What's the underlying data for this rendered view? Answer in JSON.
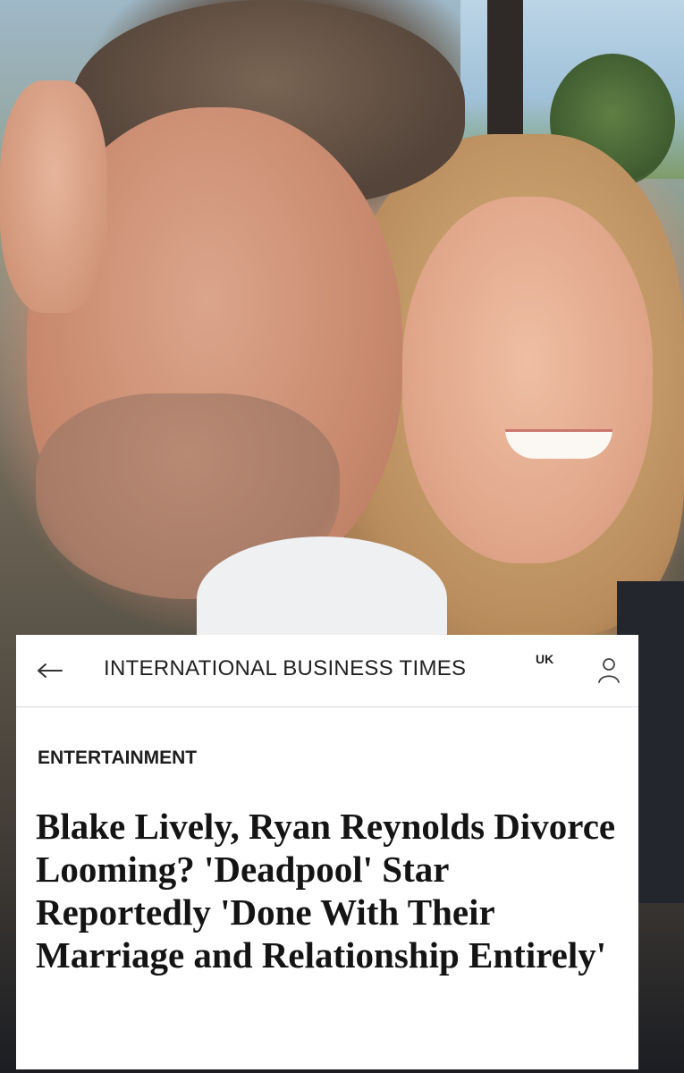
{
  "header": {
    "brand": "INTERNATIONAL BUSINESS TIMES",
    "edition": "UK",
    "back_icon": "arrow-left-icon",
    "user_icon": "user-icon"
  },
  "article": {
    "section": "ENTERTAINMENT",
    "headline": "Blake Lively, Ryan Reynolds Divorce Looming? 'Deadpool' Star Reportedly 'Done With Their Marriage and Relationship Entirely'"
  },
  "colors": {
    "text": "#141414",
    "card_bg": "#ffffff",
    "divider": "#d9d9d9"
  }
}
